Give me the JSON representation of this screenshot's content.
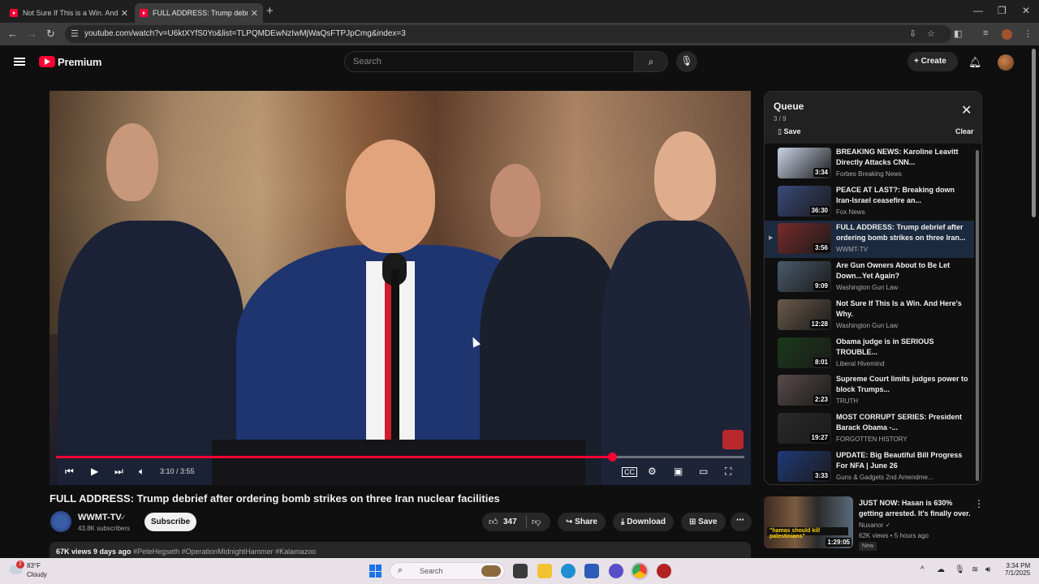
{
  "browser": {
    "tabs": [
      {
        "title": "Not Sure If This is a Win. And H"
      },
      {
        "title": "FULL ADDRESS: Trump debrief a"
      }
    ],
    "url": "youtube.com/watch?v=U6ktXYfS0Yo&list=TLPQMDEwNzIwMjWaQsFTPJpCmg&index=3"
  },
  "header": {
    "brand": "Premium",
    "search_placeholder": "Search",
    "create_label": "Create"
  },
  "player": {
    "time_current": "3:10",
    "time_total": "3:55",
    "progress": 0.808
  },
  "video": {
    "title": "FULL ADDRESS: Trump debrief after ordering bomb strikes on three Iran nuclear facilities",
    "channel": "WWMT-TV",
    "subscribers": "43.8K subscribers",
    "subscribe_label": "Subscribe",
    "likes": "347",
    "share_label": "Share",
    "download_label": "Download",
    "save_label": "Save",
    "views_date": "67K views  9 days ago",
    "hashtags": "#PeteHegseth #OperationMidnightHammer #Kalamazoo"
  },
  "queue": {
    "title": "Queue",
    "position": "3 / 9",
    "save_label": "Save",
    "clear_label": "Clear",
    "items": [
      {
        "title": "BREAKING NEWS: Karoline Leavitt Directly Attacks CNN...",
        "channel": "Forbes Breaking News",
        "duration": "3:34",
        "color": "#c9d4e6"
      },
      {
        "title": "PEACE AT LAST?: Breaking down Iran-Israel ceasefire an...",
        "channel": "Fox News",
        "duration": "36:30",
        "color": "#3a4a7a"
      },
      {
        "title": "FULL ADDRESS: Trump debrief after ordering bomb strikes on three Iran...",
        "channel": "WWMT-TV",
        "duration": "3:56",
        "color": "#7a2a2a"
      },
      {
        "title": "Are Gun Owners About to Be Let Down...Yet Again?",
        "channel": "Washington Gun Law",
        "duration": "9:09",
        "color": "#4a5a6a"
      },
      {
        "title": "Not Sure If This Is a Win. And Here's Why.",
        "channel": "Washington Gun Law",
        "duration": "12:28",
        "color": "#6a5a4a"
      },
      {
        "title": "Obama judge is in SERIOUS TROUBLE...",
        "channel": "Liberal Hivemind",
        "duration": "8:01",
        "color": "#1a3a1a"
      },
      {
        "title": "Supreme Court limits judges power to block Trumps...",
        "channel": "TRUTH",
        "duration": "2:23",
        "color": "#5a4a4a"
      },
      {
        "title": "MOST CORRUPT SERIES: President Barack Obama -...",
        "channel": "FORGOTTEN HISTORY",
        "duration": "19:27",
        "color": "#2a2a2a"
      },
      {
        "title": "UPDATE: Big Beautiful Bill Progress For NFA | June 26",
        "channel": "Guns & Gadgets 2nd Amendme...",
        "duration": "3:33",
        "color": "#1f3a7a"
      }
    ]
  },
  "recommended": {
    "title": "JUST NOW: Hasan is 630% getting arrested. It's finally over.",
    "channel": "Nuxanor",
    "meta": "62K views • 5 hours ago",
    "badge": "New",
    "duration": "1:29:05",
    "caption": "\"hamas should kill palestinians\""
  },
  "taskbar": {
    "temperature": "83°F",
    "condition": "Cloudy",
    "weather_badge": "2",
    "search_placeholder": "Search",
    "time": "3:34 PM",
    "date": "7/1/2025"
  },
  "colors": {
    "accent_red": "#ff0033",
    "bg": "#0f0f0f",
    "panel": "#212121",
    "pill": "#272727"
  }
}
